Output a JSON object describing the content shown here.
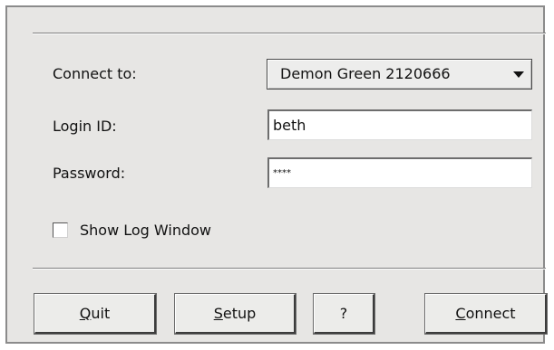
{
  "form": {
    "connect_label": "Connect to:",
    "connect_value": "Demon Green 2120666",
    "login_label": "Login ID:",
    "login_value": "beth",
    "password_label": "Password:",
    "password_value": "****",
    "show_log_label": "Show Log Window",
    "show_log_checked": false
  },
  "buttons": {
    "quit": {
      "mnemonic": "Q",
      "rest": "uit"
    },
    "setup": {
      "mnemonic": "S",
      "rest": "etup"
    },
    "help": "?",
    "connect": {
      "mnemonic": "C",
      "rest": "onnect"
    }
  },
  "icons": {
    "combo_arrow": "triangle-down-icon"
  },
  "colors": {
    "dialog_background": "#e7e6e4",
    "button_face": "#ececea",
    "field_background": "#ffffff"
  }
}
